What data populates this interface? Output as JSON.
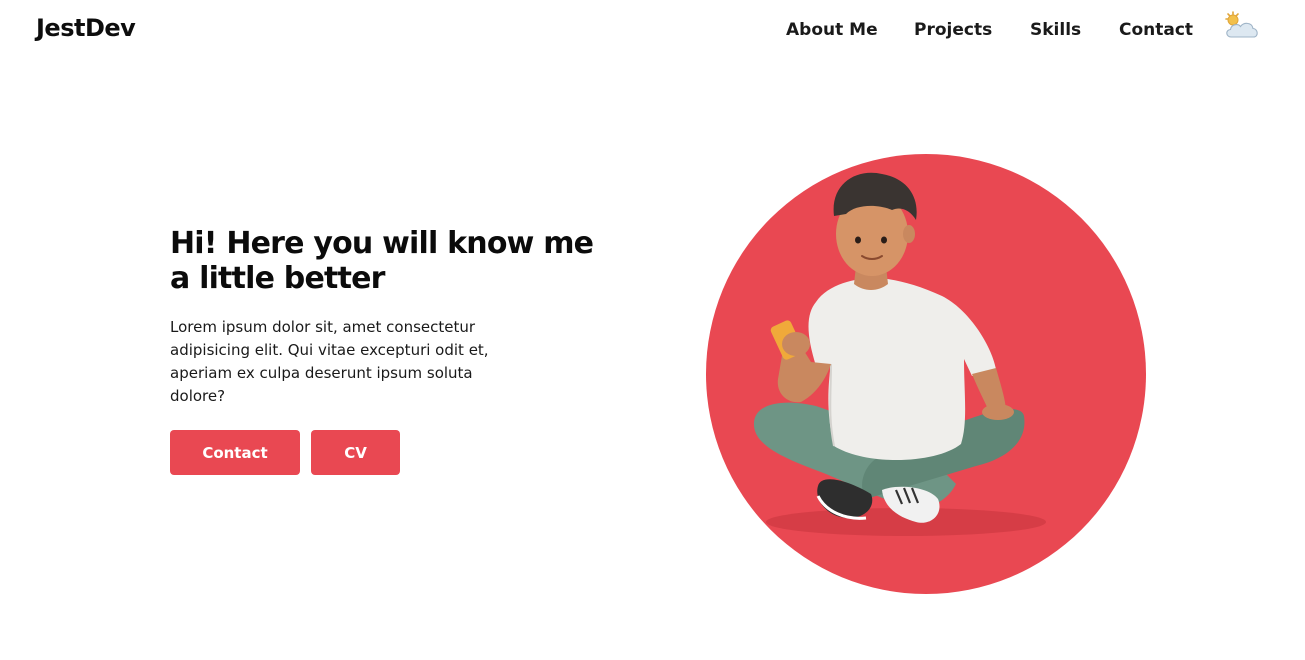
{
  "header": {
    "brand": "JestDev",
    "nav": [
      {
        "label": "About Me"
      },
      {
        "label": "Projects"
      },
      {
        "label": "Skills"
      },
      {
        "label": "Contact"
      }
    ],
    "theme_toggle_icon": "sun-behind-cloud-icon"
  },
  "hero": {
    "title": "Hi! Here you will know me a little better",
    "text": "Lorem ipsum dolor sit, amet consectetur adipisicing elit. Qui vitae excepturi odit et, aperiam ex culpa deserunt ipsum soluta dolore?",
    "buttons": {
      "contact": "Contact",
      "cv": "CV"
    },
    "illustration": "person-sitting-with-phone-illustration"
  },
  "colors": {
    "accent": "#e94852",
    "background": "#ffffff",
    "text": "#111111"
  }
}
